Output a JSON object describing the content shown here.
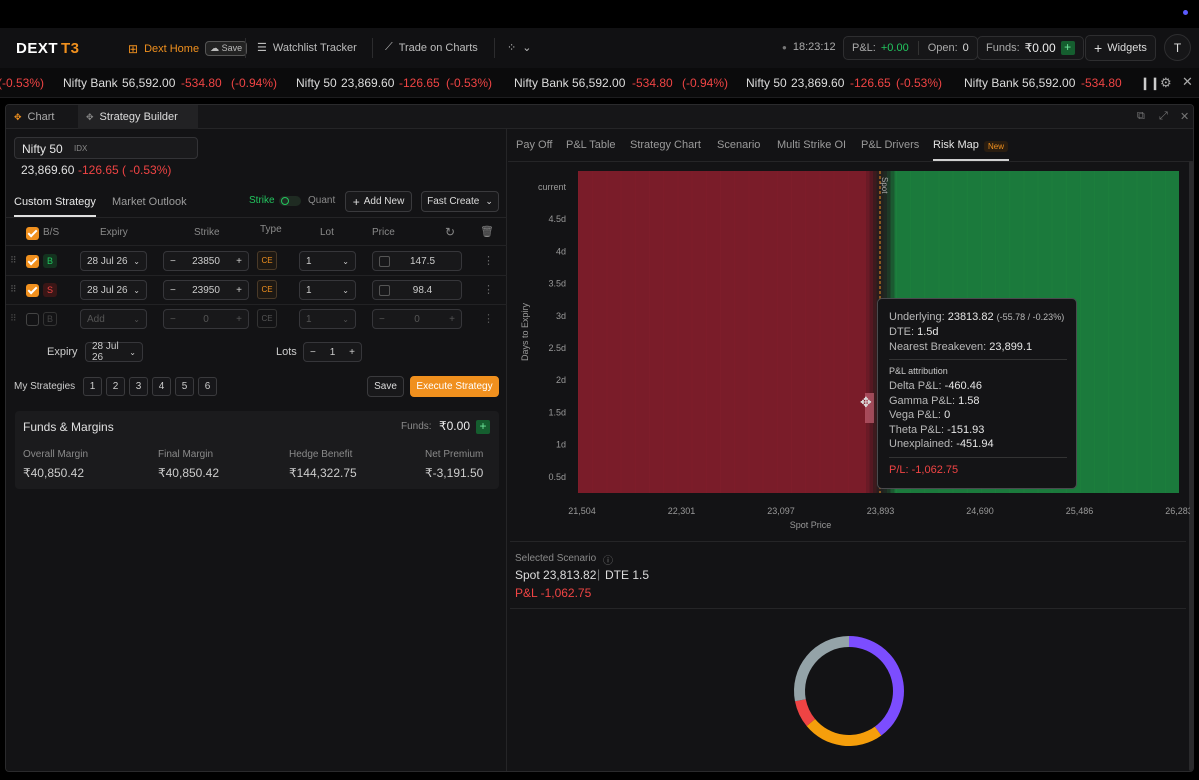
{
  "app": {
    "logo_main": "DEXT",
    "logo_sub": "T3"
  },
  "nav": {
    "home": "Dext Home",
    "save": "Save",
    "watchlist": "Watchlist Tracker",
    "trade": "Trade on Charts",
    "time": "18:23:12",
    "pnl_label": "P&L:",
    "pnl_value": "+0.00",
    "open_label": "Open:",
    "open_value": "0",
    "funds_label": "Funds:",
    "funds_value": "₹0.00",
    "widgets": "Widgets",
    "avatar": "T"
  },
  "ticker": [
    {
      "name": "",
      "price": "",
      "change": "",
      "pct": "(-0.53%)"
    },
    {
      "name": "Nifty Bank",
      "price": "56,592.00",
      "change": "-534.80",
      "pct": "(-0.94%)"
    },
    {
      "name": "Nifty 50",
      "price": "23,869.60",
      "change": "-126.65",
      "pct": "(-0.53%)"
    },
    {
      "name": "Nifty Bank",
      "price": "56,592.00",
      "change": "-534.80",
      "pct": "(-0.94%)"
    },
    {
      "name": "Nifty 50",
      "price": "23,869.60",
      "change": "-126.65",
      "pct": "(-0.53%)"
    },
    {
      "name": "Nifty Bank",
      "price": "56,592.00",
      "change": "-534.80",
      "pct": ""
    }
  ],
  "panel_tabs": {
    "chart": "Chart",
    "strategy_builder": "Strategy Builder"
  },
  "symbol": {
    "name": "Nifty 50",
    "exchange": "IDX",
    "price": "23,869.60",
    "change": "-126.65 ( -0.53%)"
  },
  "strategy": {
    "tab_custom": "Custom Strategy",
    "tab_outlook": "Market Outlook",
    "strike_label": "Strike",
    "quant_label": "Quant",
    "add_new": "Add New",
    "fast_create": "Fast Create",
    "headers": {
      "bs": "B/S",
      "expiry": "Expiry",
      "strike": "Strike",
      "type": "Type",
      "lot": "Lot",
      "price": "Price"
    },
    "legs": [
      {
        "side": "B",
        "expiry": "28 Jul 26",
        "strike": "23850",
        "type": "CE",
        "lot": "1",
        "price": "147.5"
      },
      {
        "side": "S",
        "expiry": "28 Jul 26",
        "strike": "23950",
        "type": "CE",
        "lot": "1",
        "price": "98.4"
      },
      {
        "side": "B",
        "expiry": "Add",
        "strike": "0",
        "type": "CE",
        "lot": "1",
        "price": "0"
      }
    ],
    "expiry_label": "Expiry",
    "expiry_value": "28 Jul 26",
    "lots_label": "Lots",
    "lots_value": "1",
    "my_strategies_label": "My Strategies",
    "slots": [
      "1",
      "2",
      "3",
      "4",
      "5",
      "6"
    ],
    "save": "Save",
    "execute": "Execute Strategy"
  },
  "funds": {
    "title": "Funds & Margins",
    "funds_label": "Funds:",
    "funds_value": "₹0.00",
    "items": [
      {
        "label": "Overall Margin",
        "value": "₹40,850.42"
      },
      {
        "label": "Final Margin",
        "value": "₹40,850.42"
      },
      {
        "label": "Hedge Benefit",
        "value": "₹144,322.75"
      },
      {
        "label": "Net Premium",
        "value": "₹-3,191.50"
      }
    ]
  },
  "right_tabs": [
    "Pay Off",
    "P&L Table",
    "Strategy Chart",
    "Scenario",
    "Multi Strike OI",
    "P&L Drivers",
    "Risk Map"
  ],
  "new_badge": "New",
  "riskmap": {
    "y_label": "Days to Expiry",
    "y_ticks": [
      "current",
      "4.5d",
      "4d",
      "3.5d",
      "3d",
      "2.5d",
      "2d",
      "1.5d",
      "1d",
      "0.5d"
    ],
    "x_label": "Spot Price",
    "x_ticks": [
      "21,504",
      "22,301",
      "23,097",
      "23,893",
      "24,690",
      "25,486",
      "26,283"
    ],
    "spot_marker": "Spot",
    "loss_color": "#7a1c29",
    "profit_color": "#1b7a3c"
  },
  "tooltip": {
    "underlying_label": "Underlying:",
    "underlying_value": "23813.82",
    "underlying_change": "(-55.78 / -0.23%)",
    "dte_label": "DTE:",
    "dte_value": "1.5d",
    "breakeven_label": "Nearest Breakeven:",
    "breakeven_value": "23,899.1",
    "section": "P&L attribution",
    "rows": [
      {
        "label": "Delta P&L:",
        "value": "-460.46"
      },
      {
        "label": "Gamma P&L:",
        "value": "1.58"
      },
      {
        "label": "Vega P&L:",
        "value": "0"
      },
      {
        "label": "Theta P&L:",
        "value": "-151.93"
      },
      {
        "label": "Unexplained:",
        "value": "-451.94"
      }
    ],
    "pl_label": "P/L:",
    "pl_value": "-1,062.75"
  },
  "scenario": {
    "title": "Selected Scenario",
    "spot_text": "Spot 23,813.82",
    "dte_text": "DTE 1.5",
    "pnl_text": "P&L -1,062.75"
  },
  "donut": {
    "segments": [
      {
        "color": "#7c4dff",
        "value": 40
      },
      {
        "color": "#f59e0b",
        "value": 24
      },
      {
        "color": "#ef4444",
        "value": 8
      },
      {
        "color": "#94a3a8",
        "value": 28
      }
    ]
  }
}
